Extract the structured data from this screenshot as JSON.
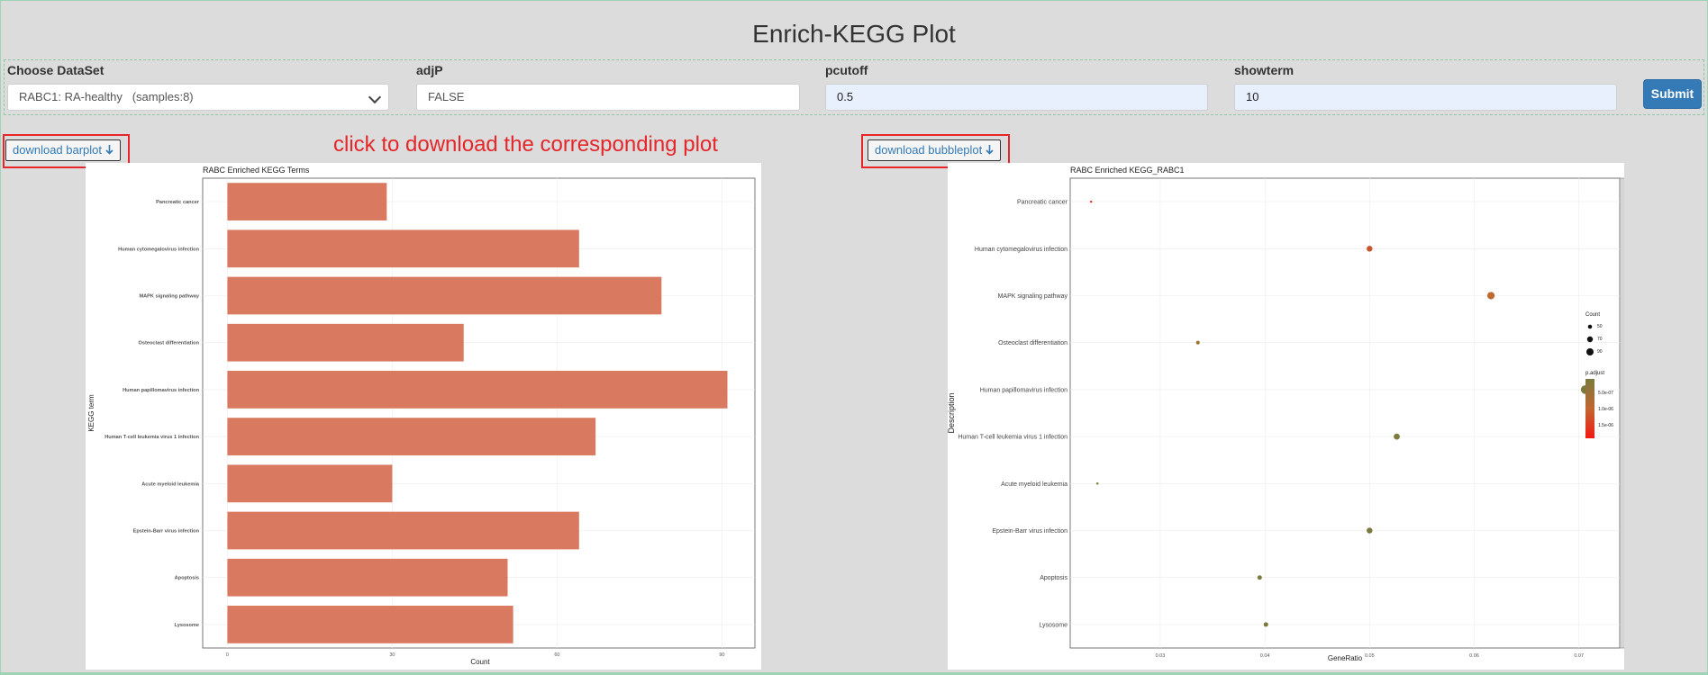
{
  "page": {
    "title": "Enrich-KEGG Plot"
  },
  "controls": {
    "dataset": {
      "label": "Choose DataSet",
      "value": "RABC1: RA-healthy   (samples:8)"
    },
    "adjp": {
      "label": "adjP",
      "value": "FALSE"
    },
    "pcutoff": {
      "label": "pcutoff",
      "value": "0.5"
    },
    "showterm": {
      "label": "showterm",
      "value": "10"
    },
    "submit_label": "Submit"
  },
  "downloads": {
    "barplot_label": "download barplot",
    "bubbleplot_label": "download bubbleplot",
    "arrow_icon": "arrow-down-icon"
  },
  "annotation": {
    "text": "click to download the corresponding plot",
    "color": "#e5262a"
  },
  "colors": {
    "bar": "#d97a60",
    "submit": "#337ab7",
    "annotation": "#e5262a"
  },
  "chart_data": [
    {
      "type": "bar",
      "orientation": "horizontal",
      "title": "RABC Enriched KEGG Terms",
      "xlabel": "Count",
      "ylabel": "KEGG term",
      "categories": [
        "Pancreatic cancer",
        "Human cytomegalovirus infection",
        "MAPK signaling pathway",
        "Osteoclast differentiation",
        "Human papillomavirus infection",
        "Human T-cell leukemia virus 1 infection",
        "Acute myeloid leukemia",
        "Epstein-Barr virus infection",
        "Apoptosis",
        "Lysosome"
      ],
      "values": [
        29,
        64,
        79,
        43,
        91,
        67,
        30,
        64,
        51,
        52
      ],
      "xticks": [
        0,
        30,
        60,
        90
      ],
      "xlim": [
        -4.5,
        96
      ],
      "grid": true
    },
    {
      "type": "scatter",
      "title": "RABC Enriched KEGG_RABC1",
      "xlabel": "GeneRatio",
      "ylabel": "Description",
      "facet_label": "RABC1",
      "categories": [
        "Pancreatic cancer",
        "Human cytomegalovirus infection",
        "MAPK signaling pathway",
        "Osteoclast differentiation",
        "Human papillomavirus infection",
        "Human T-cell leukemia virus 1 infection",
        "Acute myeloid leukemia",
        "Epstein-Barr virus infection",
        "Apoptosis",
        "Lysosome"
      ],
      "x": [
        0.0234,
        0.05,
        0.0616,
        0.0336,
        0.0706,
        0.0526,
        0.024,
        0.05,
        0.0395,
        0.0401
      ],
      "size": [
        29,
        64,
        79,
        43,
        91,
        67,
        30,
        64,
        51,
        52
      ],
      "color": [
        "#e8231a",
        "#c8552e",
        "#bc6a32",
        "#99742f",
        "#7a7a3e",
        "#7e7d3d",
        "#7a7a3e",
        "#7a7a3e",
        "#7a7a3e",
        "#7a7a3e"
      ],
      "xticks": [
        0.03,
        0.04,
        0.05,
        0.06,
        0.07
      ],
      "xlim": [
        0.0214,
        0.0739
      ],
      "legend": {
        "size_title": "Count",
        "size_entries": [
          "50",
          "70",
          "90"
        ],
        "color_title": "p.adjust",
        "color_entries": [
          "5.0e-07",
          "1.0e-06",
          "1.5e-06"
        ],
        "placement": "right"
      },
      "grid": true
    }
  ]
}
